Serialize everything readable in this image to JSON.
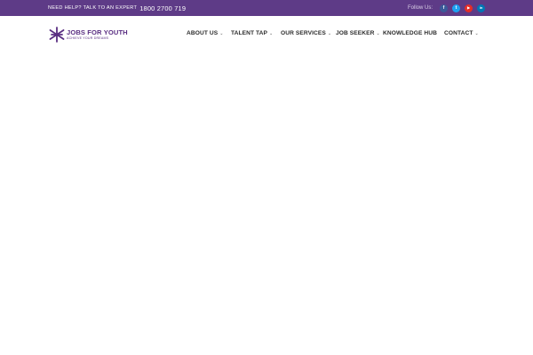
{
  "topbar": {
    "help_text": "NEED HELP? TALK TO AN EXPERT",
    "phone": "1800 2700 719",
    "follow_label": "Follow Us:",
    "social": [
      {
        "icon": "facebook-icon",
        "glyph": "f",
        "color": "#3b5998"
      },
      {
        "icon": "twitter-icon",
        "glyph": "t",
        "color": "#1da1f2"
      },
      {
        "icon": "youtube-icon",
        "glyph": "▶",
        "color": "#e52d27"
      },
      {
        "icon": "linkedin-icon",
        "glyph": "in",
        "color": "#0077b5"
      }
    ],
    "background": "#5e3b87"
  },
  "logo": {
    "brand": "JOBS FOR YOUTH",
    "tagline": "ACHIEVE YOUR DREAMS",
    "color": "#5a2e82"
  },
  "nav": {
    "items": [
      {
        "label": "ABOUT US",
        "has_dropdown": true
      },
      {
        "label": "TALENT TAP",
        "has_dropdown": true
      },
      {
        "label": "OUR SERVICES",
        "has_dropdown": true
      },
      {
        "label": "JOB SEEKER",
        "has_dropdown": true
      },
      {
        "label": "KNOWLEDGE HUB",
        "has_dropdown": false
      },
      {
        "label": "CONTACT",
        "has_dropdown": true
      }
    ],
    "chevron": "⌄"
  }
}
